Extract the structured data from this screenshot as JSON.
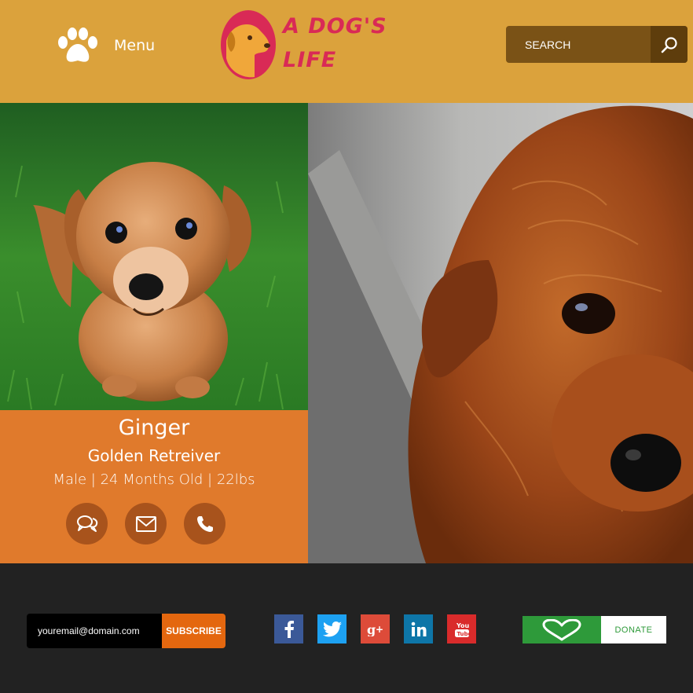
{
  "header": {
    "menu_label": "Menu",
    "logo": {
      "line1": "A DOG'S",
      "line2": "LIFE"
    },
    "search": {
      "placeholder": "SEARCH"
    }
  },
  "dog": {
    "name": "Ginger",
    "breed": "Golden Retreiver",
    "details": "Male | 24 Months Old | 22lbs"
  },
  "card_actions": [
    {
      "icon": "chat-icon"
    },
    {
      "icon": "envelope-icon"
    },
    {
      "icon": "phone-icon"
    }
  ],
  "footer": {
    "email_placeholder": "youremail@domain.com",
    "subscribe_label": "SUBSCRIBE",
    "social": [
      {
        "icon": "facebook-icon",
        "color": "#3b5998"
      },
      {
        "icon": "twitter-icon",
        "color": "#1da1f2"
      },
      {
        "icon": "google-plus-icon",
        "color": "#dd4b39"
      },
      {
        "icon": "linkedin-icon",
        "color": "#0e76a8"
      },
      {
        "icon": "youtube-icon",
        "color": "#d92b2b"
      }
    ],
    "donate_label": "DONATE"
  },
  "colors": {
    "header_bg": "#dba23c",
    "card_bg": "#e07a2c",
    "footer_bg": "#222222",
    "logo_red": "#d92a56",
    "donate_green": "#2e9a3a",
    "subscribe_orange": "#e4670f"
  }
}
